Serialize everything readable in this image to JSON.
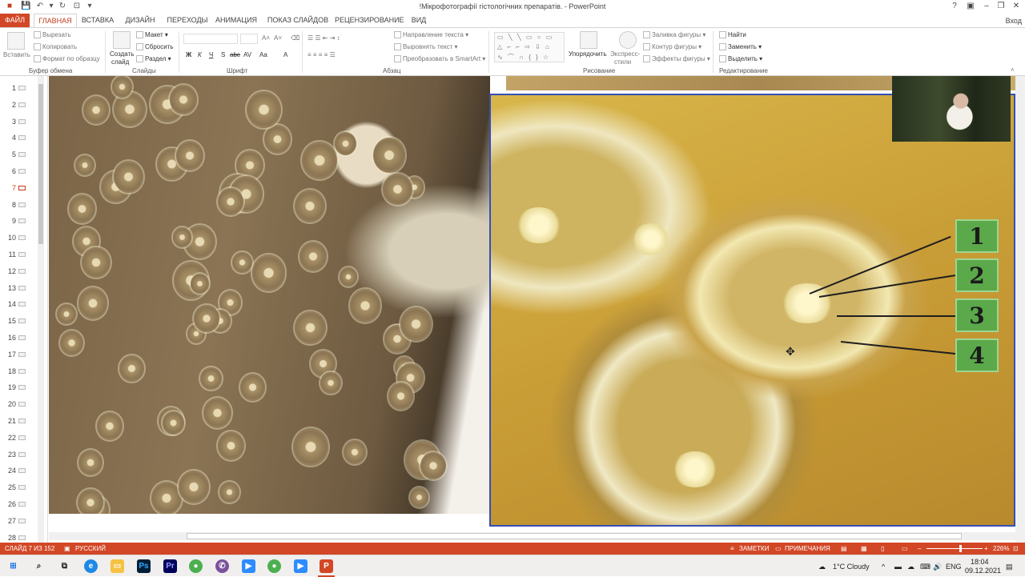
{
  "window": {
    "title": "!Мікрофотографії гістологічних препаратів. - PowerPoint",
    "quick_access": [
      "save-icon",
      "undo-icon",
      "redo-icon",
      "refresh-icon",
      "present-icon"
    ],
    "controls": [
      "?",
      "▣",
      "–",
      "❐",
      "✕"
    ]
  },
  "tabs": [
    {
      "label": "ФАЙЛ"
    },
    {
      "label": "ГЛАВНАЯ"
    },
    {
      "label": "ВСТАВКА"
    },
    {
      "label": "ДИЗАЙН"
    },
    {
      "label": "ПЕРЕХОДЫ"
    },
    {
      "label": "АНИМАЦИЯ"
    },
    {
      "label": "ПОКАЗ СЛАЙДОВ"
    },
    {
      "label": "РЕЦЕНЗИРОВАНИЕ"
    },
    {
      "label": "ВИД"
    }
  ],
  "signin": "Вход",
  "ribbon": {
    "clipboard": {
      "paste": "Вставить",
      "cut": "Вырезать",
      "copy": "Копировать",
      "format_painter": "Формат по образцу",
      "group": "Буфер обмена"
    },
    "slides": {
      "new_slide": "Создать",
      "new_slide2": "слайд",
      "layout": "Макет",
      "reset": "Сбросить",
      "section": "Раздел",
      "group": "Слайды"
    },
    "font": {
      "group": "Шрифт",
      "buttons": [
        "Ж",
        "К",
        "Ч",
        "S",
        "abc",
        "AV",
        "Aa",
        "A"
      ]
    },
    "paragraph": {
      "text_direction": "Направление текста",
      "align_text": "Выровнять текст",
      "smartart": "Преобразовать в SmartArt",
      "group": "Абзац"
    },
    "drawing": {
      "arrange": "Упорядочить",
      "quick_styles": "Экспресс-",
      "quick_styles2": "стили",
      "shape_fill": "Заливка фигуры",
      "shape_outline": "Контур фигуры",
      "shape_effects": "Эффекты фигуры",
      "group": "Рисование"
    },
    "editing": {
      "find": "Найти",
      "replace": "Заменить",
      "select": "Выделить",
      "group": "Редактирование"
    }
  },
  "thumbnails": {
    "numbers": [
      "1",
      "2",
      "3",
      "4",
      "5",
      "6",
      "7",
      "8",
      "9",
      "10",
      "11",
      "12",
      "13",
      "14",
      "15",
      "16",
      "17",
      "18",
      "19",
      "20",
      "21",
      "22",
      "23",
      "24",
      "25",
      "26",
      "27",
      "28"
    ],
    "selected": "7"
  },
  "slide": {
    "labels": [
      "1",
      "2",
      "3",
      "4"
    ]
  },
  "status": {
    "slide": "СЛАЙД 7 ИЗ 152",
    "language": "РУССКИЙ",
    "notes": "ЗАМЕТКИ",
    "comments": "ПРИМЕЧАНИЯ",
    "zoom": "226%"
  },
  "taskbar": {
    "weather": "1°C  Cloudy",
    "lang": "ENG",
    "time": "18:04",
    "date": "09.12.2021",
    "apps": [
      "start-icon",
      "search-icon",
      "task-view-icon",
      "edge-icon",
      "file-explorer-icon",
      "photoshop-icon",
      "premiere-icon",
      "chrome-icon",
      "viber-icon",
      "zoom-icon",
      "chrome-icon-2",
      "zoom-icon-2",
      "powerpoint-icon"
    ]
  },
  "colors": {
    "accent": "#d24726",
    "selection_border": "#3350b6",
    "label_green": "#5ba94a"
  }
}
